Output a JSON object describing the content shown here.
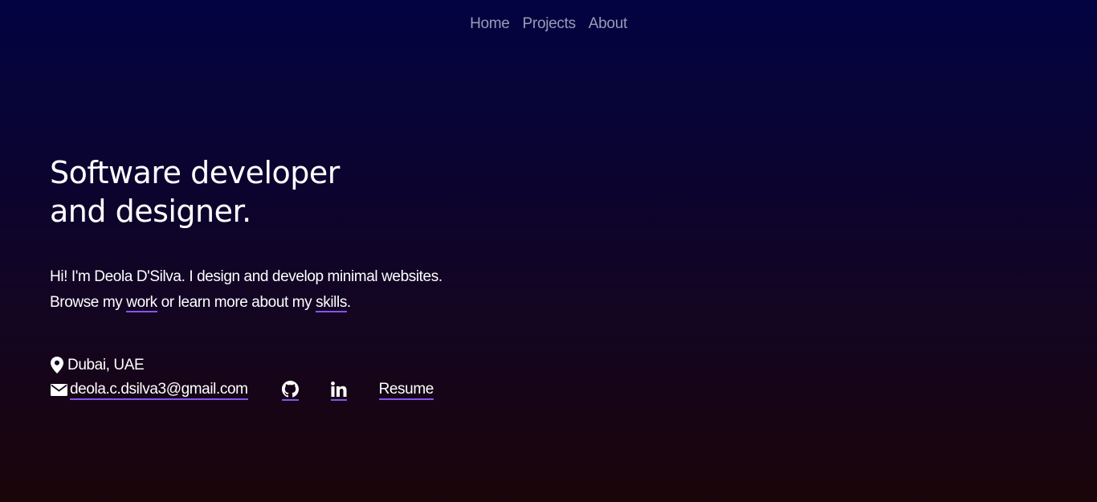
{
  "nav": {
    "items": [
      {
        "label": "Home"
      },
      {
        "label": "Projects"
      },
      {
        "label": "About"
      }
    ]
  },
  "hero": {
    "headline_line1": "Software developer",
    "headline_line2": "and designer."
  },
  "intro": {
    "line1": "Hi! I'm Deola D'Silva. I design and develop minimal websites.",
    "line2_prefix": "Browse my ",
    "work_link": "work",
    "line2_middle": " or learn more about my ",
    "skills_link": "skills",
    "line2_suffix": "."
  },
  "contact": {
    "location_icon": "map-pin-icon",
    "location": "Dubai, UAE",
    "email_icon": "envelope-icon",
    "email": " deola.c.dsilva3@gmail.com",
    "github_icon": "github-icon",
    "linkedin_icon": "linkedin-icon",
    "resume_label": "Resume"
  },
  "colors": {
    "background_top": "#020341",
    "background_bottom": "#1a0509",
    "link_underline": "#8356f0",
    "nav_text": "#9a9ab8"
  }
}
